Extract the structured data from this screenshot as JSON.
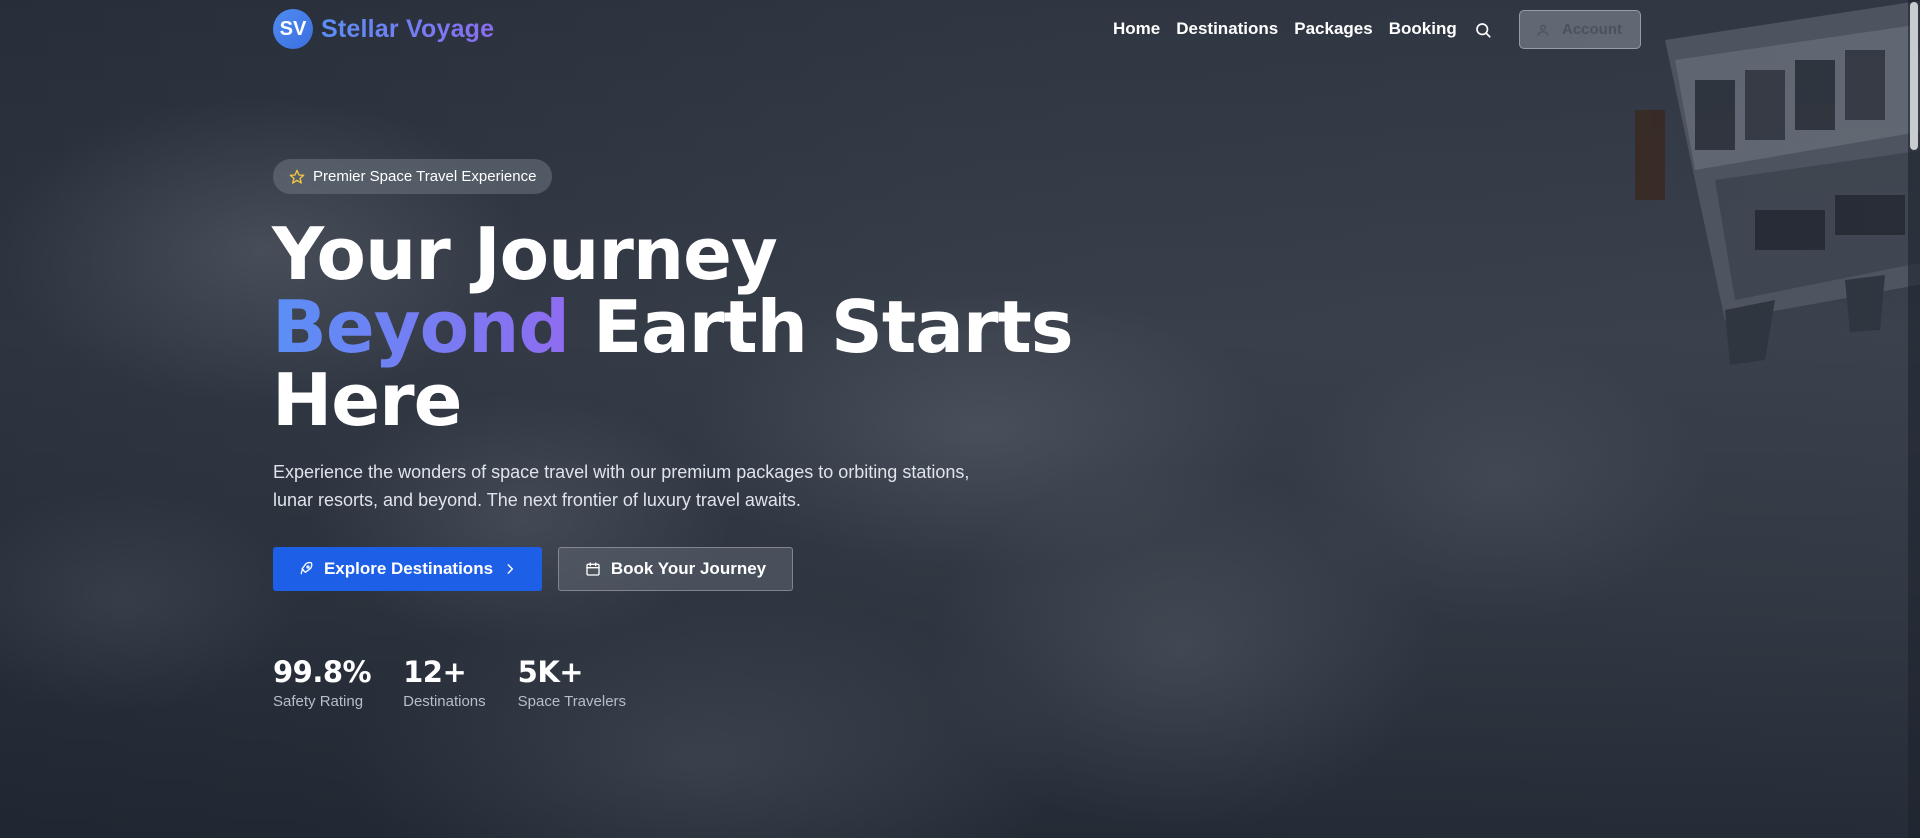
{
  "brand": {
    "initials": "SV",
    "name": "Stellar Voyage"
  },
  "nav": {
    "links": [
      "Home",
      "Destinations",
      "Packages",
      "Booking"
    ],
    "search_icon": "search-icon",
    "account_label": "Account"
  },
  "hero": {
    "badge": "Premier Space Travel Experience",
    "headline_line1": "Your Journey",
    "headline_accent": "Beyond",
    "headline_line2_rest": " Earth Starts",
    "headline_line3": "Here",
    "subtext": "Experience the wonders of space travel with our premium packages to orbiting stations, lunar resorts, and beyond. The next frontier of luxury travel awaits.",
    "primary_cta": "Explore Destinations",
    "secondary_cta": "Book Your Journey"
  },
  "stats": [
    {
      "value": "99.8%",
      "label": "Safety Rating"
    },
    {
      "value": "12+",
      "label": "Destinations"
    },
    {
      "value": "5K+",
      "label": "Space Travelers"
    }
  ],
  "colors": {
    "primary": "#1d5fe6",
    "accent_start": "#5b8ff5",
    "accent_end": "#8f6cf0"
  }
}
